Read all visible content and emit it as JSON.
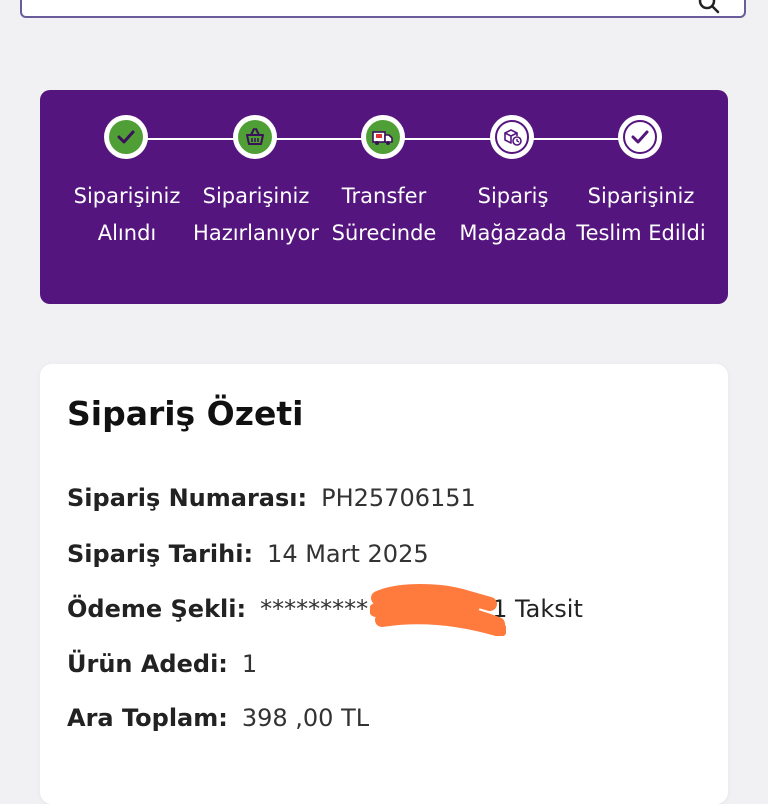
{
  "steps": [
    {
      "label": "Siparişiniz Alındı",
      "icon": "checkmark-icon",
      "state": "done"
    },
    {
      "label": "Siparişiniz Hazırlanıyor",
      "icon": "basket-icon",
      "state": "done"
    },
    {
      "label": "Transfer Sürecinde",
      "icon": "delivery-truck-icon",
      "state": "done"
    },
    {
      "label": "Sipariş Mağazada",
      "icon": "store-package-icon",
      "state": "pending"
    },
    {
      "label": "Siparişiniz Teslim Edildi",
      "icon": "checkmark-icon",
      "state": "pending"
    }
  ],
  "summary": {
    "title": "Sipariş Özeti",
    "order_number_label": "Sipariş Numarası:",
    "order_number": "PH25706151",
    "order_date_label": "Sipariş Tarihi:",
    "order_date": "14 Mart 2025",
    "payment_label": "Ödeme Şekli:",
    "payment_masked": "*********",
    "payment_installment": "1 Taksit",
    "quantity_label": "Ürün Adedi:",
    "quantity": "1",
    "subtotal_label": "Ara Toplam:",
    "subtotal": "398 ,00 TL"
  },
  "colors": {
    "tracker_bg": "#54157e",
    "done_green": "#4f9f36",
    "redaction": "#ff7a3d"
  }
}
